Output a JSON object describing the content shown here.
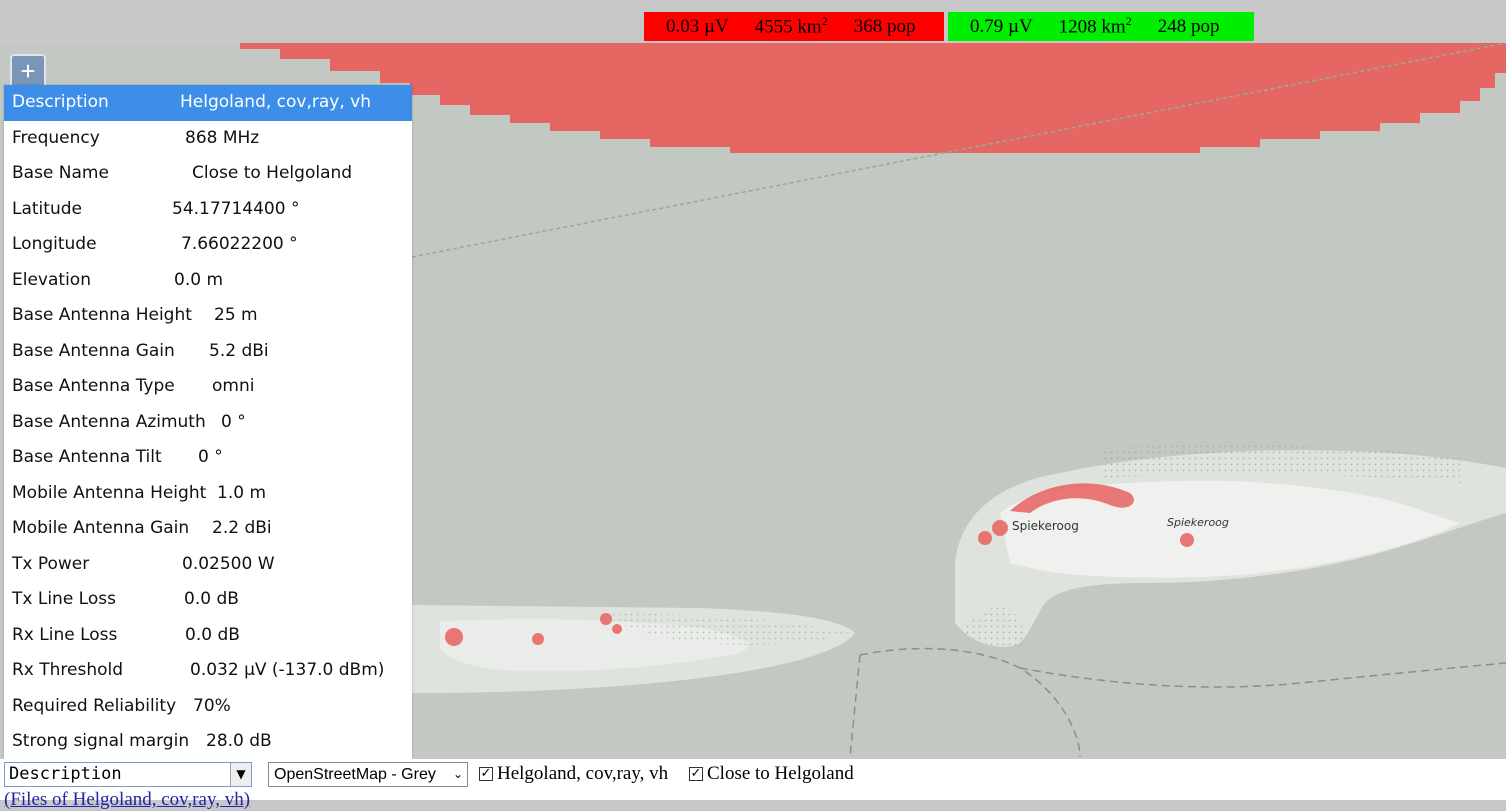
{
  "legend": {
    "red": {
      "voltage": "0.03 µV",
      "area": "4555 km",
      "area_sup": "2",
      "pop": "368 pop",
      "color": "#ff0000"
    },
    "green": {
      "voltage": "0.79 µV",
      "area": "1208 km",
      "area_sup": "2",
      "pop": "248 pop",
      "color": "#00ee00"
    }
  },
  "map": {
    "labels": [
      "Spiekeroog",
      "Spiekeroog"
    ],
    "coverage_color": "#e8615f",
    "sea_color": "#c3c8c2",
    "land_color": "#e8ebe7"
  },
  "zoom": {
    "label": "+"
  },
  "info": {
    "header": {
      "key": "Description",
      "value": "Helgoland, cov,ray, vh"
    },
    "rows": [
      {
        "key": "Frequency",
        "value": "868 MHz"
      },
      {
        "key": "Base Name",
        "value": "Close to Helgoland"
      },
      {
        "key": "Latitude",
        "value": "54.17714400 °"
      },
      {
        "key": "Longitude",
        "value": "7.66022200 °"
      },
      {
        "key": "Elevation",
        "value": "0.0 m"
      },
      {
        "key": "Base Antenna Height",
        "value": "25 m"
      },
      {
        "key": "Base Antenna Gain",
        "value": "5.2 dBi"
      },
      {
        "key": "Base Antenna Type",
        "value": "omni"
      },
      {
        "key": "Base Antenna Azimuth",
        "value": "0 °"
      },
      {
        "key": "Base Antenna Tilt",
        "value": "0 °"
      },
      {
        "key": "Mobile Antenna Height",
        "value": "1.0 m"
      },
      {
        "key": "Mobile Antenna Gain",
        "value": "2.2 dBi"
      },
      {
        "key": "Tx Power",
        "value": "0.02500 W"
      },
      {
        "key": "Tx Line Loss",
        "value": "0.0 dB"
      },
      {
        "key": "Rx Line Loss",
        "value": "0.0 dB"
      },
      {
        "key": "Rx Threshold",
        "value": "0.032 µV (-137.0 dBm)"
      },
      {
        "key": "Required Reliability",
        "value": "70%"
      },
      {
        "key": "Strong signal margin",
        "value": "28.0 dB"
      }
    ]
  },
  "controls": {
    "layer_select": "Description",
    "base_select": "OpenStreetMap - Grey",
    "checkbox1": {
      "label": "Helgoland, cov,ray, vh",
      "checked": true
    },
    "checkbox2": {
      "label": "Close to Helgoland",
      "checked": true
    },
    "files_link": "(Files of Helgoland, cov,ray, vh)"
  }
}
